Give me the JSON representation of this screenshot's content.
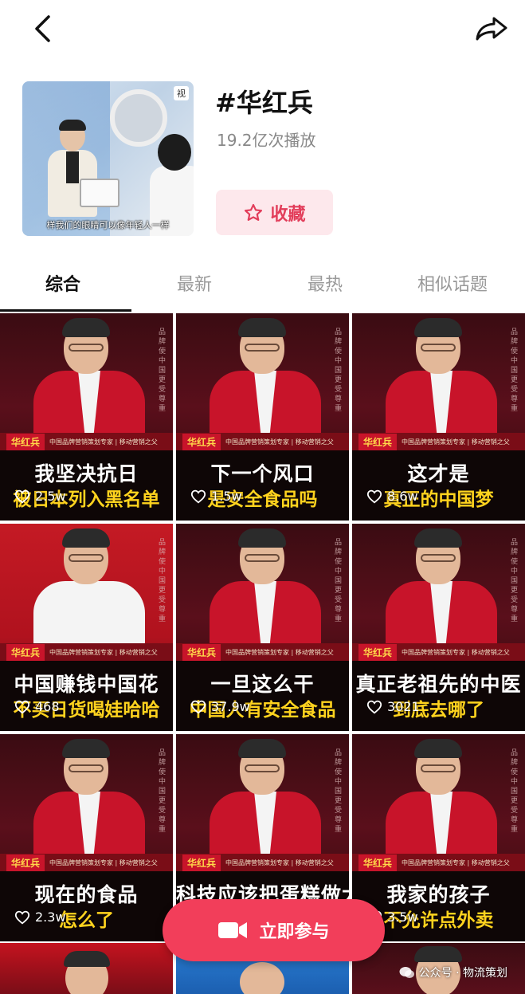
{
  "topic": {
    "title": "#华红兵",
    "plays": "19.2亿次播放",
    "fav_label": "收藏"
  },
  "cover": {
    "logo": "视",
    "subtitle": "样我们的眼睛可以像年轻人一样"
  },
  "tabs": [
    "综合",
    "最新",
    "最热",
    "相似话题"
  ],
  "cards": [
    {
      "line1": "我坚决抗日",
      "line2": "被日本列入黑名单",
      "likes": "2.5w",
      "style": "red"
    },
    {
      "line1": "下一个风口",
      "line2": "是安全食品吗",
      "likes": "1.5w",
      "style": "red"
    },
    {
      "line1": "这才是",
      "line2": "真正的中国梦",
      "likes": "8.6w",
      "style": "red"
    },
    {
      "line1": "中国赚钱中国花",
      "line2": "不买日货喝娃哈哈",
      "likes": "468",
      "style": "white"
    },
    {
      "line1": "一旦这么干",
      "line2": "中国人有安全食品",
      "likes": "37.9w",
      "style": "red"
    },
    {
      "line1": "真正老祖先的中医",
      "line2": "到底去哪了",
      "likes": "3021",
      "style": "red"
    },
    {
      "line1": "现在的食品",
      "line2": "怎么了",
      "likes": "2.3w",
      "style": "red"
    },
    {
      "line1": "科技应该把蛋糕做大",
      "line2": "",
      "likes": "",
      "style": "red"
    },
    {
      "line1": "我家的孩子",
      "line2": "不允许点外卖",
      "likes": "3.5w",
      "style": "red"
    }
  ],
  "card_common": {
    "name": "华红兵",
    "tagline": "中国品牌营销策划专家 | 移动营销之父",
    "side_text": "品牌使中国更受尊重"
  },
  "cta": {
    "label": "立即参与"
  },
  "watermark": "公众号 · 物流策划",
  "colors": {
    "accent": "#f23e5a",
    "fav_bg": "#fde8ec",
    "caption_yellow": "#ffd31e"
  }
}
